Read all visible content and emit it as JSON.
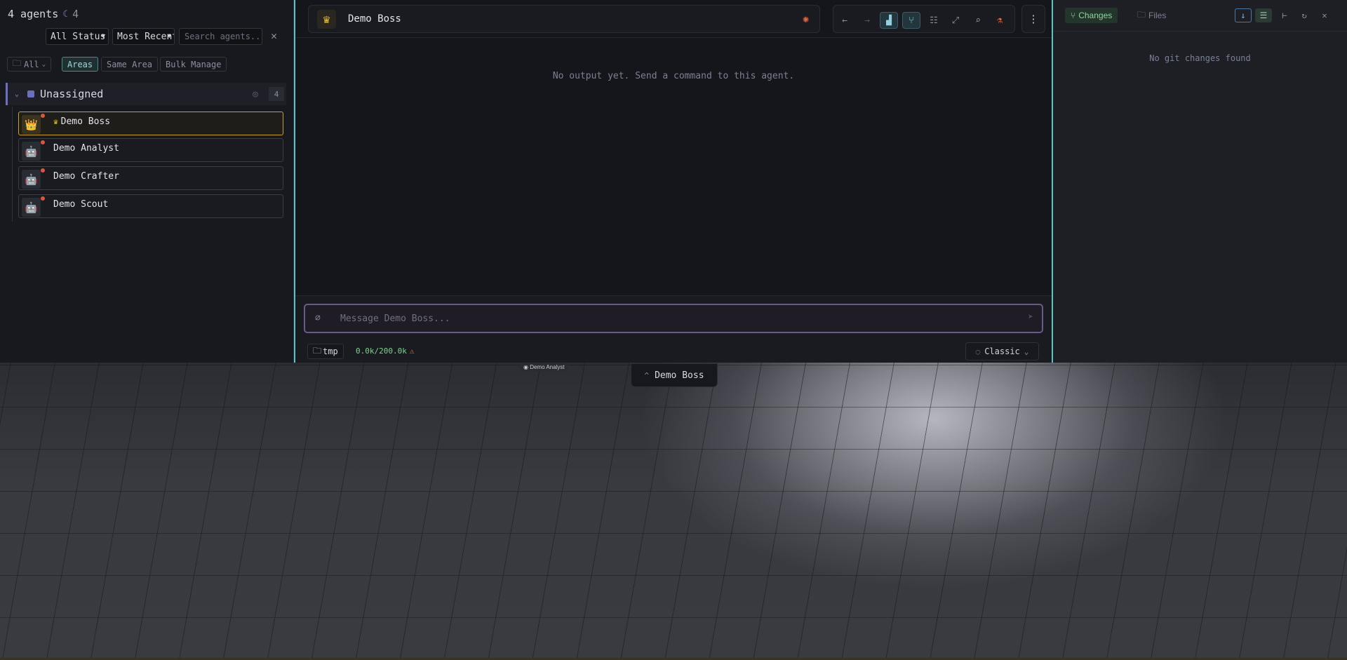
{
  "sidebar": {
    "agent_count_label": "4 agents",
    "idle_count": "4",
    "status_filter": "All Status",
    "sort_filter": "Most Recent",
    "search_placeholder": "Search agents...",
    "filters": {
      "all": "All",
      "areas": "Areas",
      "same_area": "Same Area",
      "bulk_manage": "Bulk Manage"
    },
    "group": {
      "name": "Unassigned",
      "count": "4"
    },
    "agents": [
      {
        "name": "Demo Boss",
        "icon": "crown-icon",
        "selected": true
      },
      {
        "name": "Demo Analyst",
        "icon": "robot-icon"
      },
      {
        "name": "Demo Crafter",
        "icon": "robot-icon"
      },
      {
        "name": "Demo Scout",
        "icon": "robot-icon"
      }
    ]
  },
  "main": {
    "agent_title": "Demo Boss",
    "empty_message": "No output yet. Send a command to this agent.",
    "composer_placeholder": "Message Demo Boss...",
    "path": "tmp",
    "tokens": "0.0k/200.0k",
    "mode": "Classic"
  },
  "right_panel": {
    "tab_changes": "Changes",
    "tab_files": "Files",
    "empty_message": "No git changes found"
  },
  "scene": {
    "floating_label": "Demo Analyst",
    "selected_tag": "Demo Boss"
  },
  "colors": {
    "accent_teal": "#52c7c5",
    "boss_gold": "#c9a227",
    "status_red": "#d9573f",
    "token_green": "#7ed48a"
  }
}
